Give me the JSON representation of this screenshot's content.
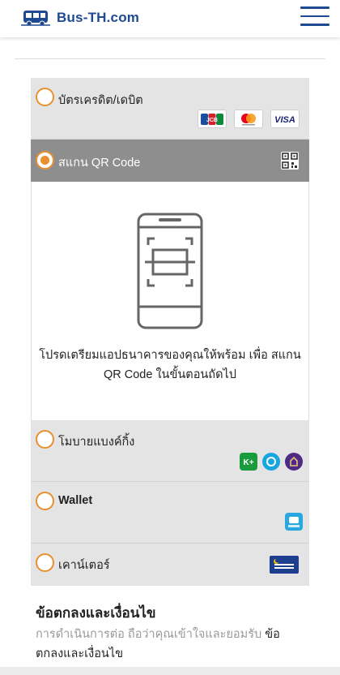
{
  "header": {
    "site_name": "Bus-TH.com",
    "logo_icon": "bus-logo-icon",
    "menu_icon": "hamburger-menu-icon",
    "brand_color": "#1d4a92"
  },
  "payment": {
    "accent_color": "#e8902f",
    "options": [
      {
        "label": "บัตรเครดิต/เดบิต",
        "selected": false,
        "logos": [
          "JCB",
          "Mastercard",
          "VISA"
        ]
      },
      {
        "label": "สแกน QR Code",
        "selected": true,
        "icon": "qr-code-icon"
      },
      {
        "label": "โมบายแบงค์กิ้ง",
        "selected": false,
        "logos": [
          "K+",
          "Krungthai",
          "SCB"
        ]
      },
      {
        "label": "Wallet",
        "selected": false,
        "logos": [
          "เป๋าตัง"
        ]
      },
      {
        "label": "เคาน์เตอร์",
        "selected": false,
        "logos": [
          "เคาน์เตอร์เซอร์วิส"
        ]
      }
    ],
    "qr_instruction": "โปรดเตรียมแอปธนาคารของคุณให้พร้อม เพื่อ สแกน QR Code ในขั้นตอนถัดไป"
  },
  "terms": {
    "title": "ข้อตกลงและเงื่อนไข",
    "text": "การดำเนินการต่อ ถือว่าคุณเข้าใจและยอมรับ ",
    "link": "ข้อตกลงและเงื่อนไข"
  }
}
